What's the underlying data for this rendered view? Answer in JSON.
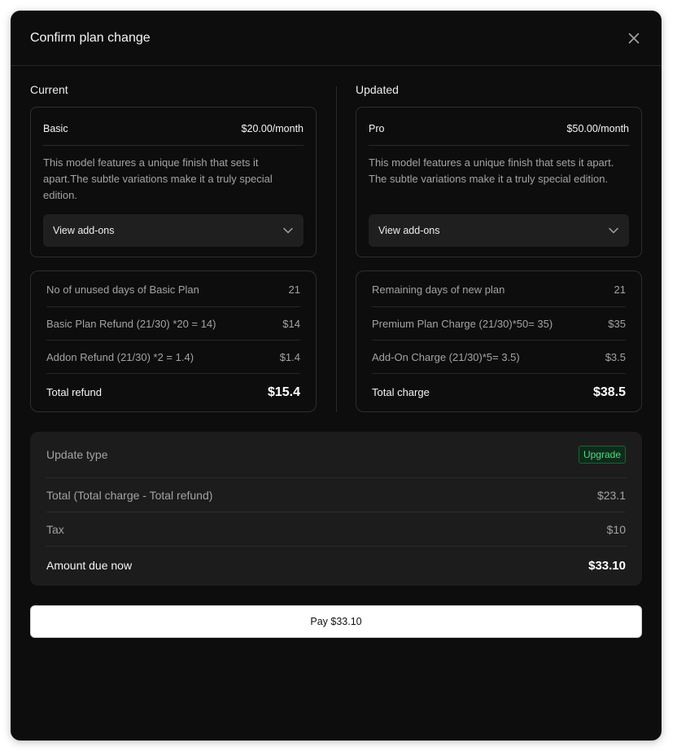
{
  "modal": {
    "title": "Confirm plan change"
  },
  "current": {
    "section_label": "Current",
    "plan_name": "Basic",
    "plan_price": "$20.00/month",
    "description": "This model features a unique finish that sets it apart.The subtle variations make it a truly special edition.",
    "addons_label": "View add-ons",
    "rows": [
      {
        "label": "No of unused days of Basic Plan",
        "value": "21"
      },
      {
        "label": "Basic Plan Refund (21/30) *20 = 14)",
        "value": "$14"
      },
      {
        "label": "Addon Refund (21/30) *2 = 1.4)",
        "value": "$1.4"
      }
    ],
    "total_label": "Total refund",
    "total_value": "$15.4"
  },
  "updated": {
    "section_label": "Updated",
    "plan_name": "Pro",
    "plan_price": "$50.00/month",
    "description": "This model features a unique finish that sets it apart. The subtle variations make it a truly special edition.",
    "addons_label": "View add-ons",
    "rows": [
      {
        "label": "Remaining days of new plan",
        "value": "21"
      },
      {
        "label": "Premium Plan Charge (21/30)*50= 35)",
        "value": "$35"
      },
      {
        "label": "Add-On Charge (21/30)*5= 3.5)",
        "value": "$3.5"
      }
    ],
    "total_label": "Total charge",
    "total_value": "$38.5"
  },
  "summary": {
    "update_type_label": "Update type",
    "update_type_badge": "Upgrade",
    "total_label": "Total (Total charge - Total refund)",
    "total_value": "$23.1",
    "tax_label": "Tax",
    "tax_value": "$10",
    "due_label": "Amount due now",
    "due_value": "$33.10"
  },
  "pay_button": {
    "label": "Pay $33.10"
  },
  "icons": {
    "close": "close-icon",
    "chevron": "chevron-down-icon"
  },
  "colors": {
    "modal_bg": "#0d0d0d",
    "summary_bg": "#1c1c1c",
    "badge_text": "#4ade80",
    "badge_bg": "#0f2a1a",
    "button_bg": "#ffffff"
  }
}
